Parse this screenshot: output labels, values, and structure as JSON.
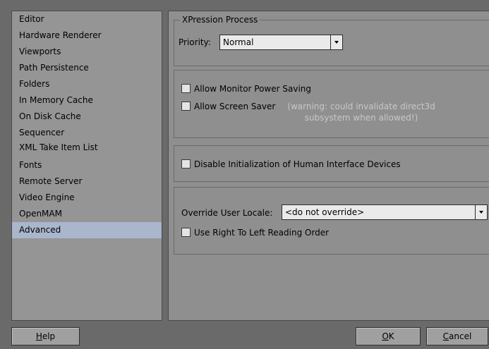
{
  "sidebar": {
    "items": [
      {
        "label": "Editor"
      },
      {
        "label": "Hardware Renderer"
      },
      {
        "label": "Viewports"
      },
      {
        "label": "Path Persistence"
      },
      {
        "label": "Folders"
      },
      {
        "label": "In Memory Cache"
      },
      {
        "label": "On Disk Cache"
      },
      {
        "label": "Sequencer"
      },
      {
        "label": "XML Take Item List"
      },
      {
        "label": "Fonts"
      },
      {
        "label": "Remote Server"
      },
      {
        "label": "Video Engine"
      },
      {
        "label": "OpenMAM"
      },
      {
        "label": "Advanced"
      }
    ],
    "selected": "Advanced"
  },
  "process_group": {
    "title": "XPression Process",
    "priority_label": "Priority:",
    "priority_value": "Normal"
  },
  "power_group": {
    "monitor_power_saving_label": "Allow Monitor Power Saving",
    "monitor_power_saving_checked": false,
    "screen_saver_label": "Allow Screen Saver",
    "screen_saver_checked": false,
    "warning_line1": "(warning: could invalidate direct3d",
    "warning_line2": "subsystem when allowed!)"
  },
  "hid_group": {
    "disable_hid_label": "Disable Initialization of Human Interface Devices",
    "disable_hid_checked": false
  },
  "locale_group": {
    "override_label": "Override User Locale:",
    "override_value": "<do not override>",
    "rtl_label": "Use Right To Left Reading Order",
    "rtl_checked": false
  },
  "buttons": {
    "help_first": "H",
    "help_rest": "elp",
    "ok_first": "O",
    "ok_rest": "K",
    "cancel_first": "C",
    "cancel_rest": "ancel"
  },
  "colors": {
    "selection": "#a9b6cc",
    "warning_text": "#c8c8c8"
  }
}
